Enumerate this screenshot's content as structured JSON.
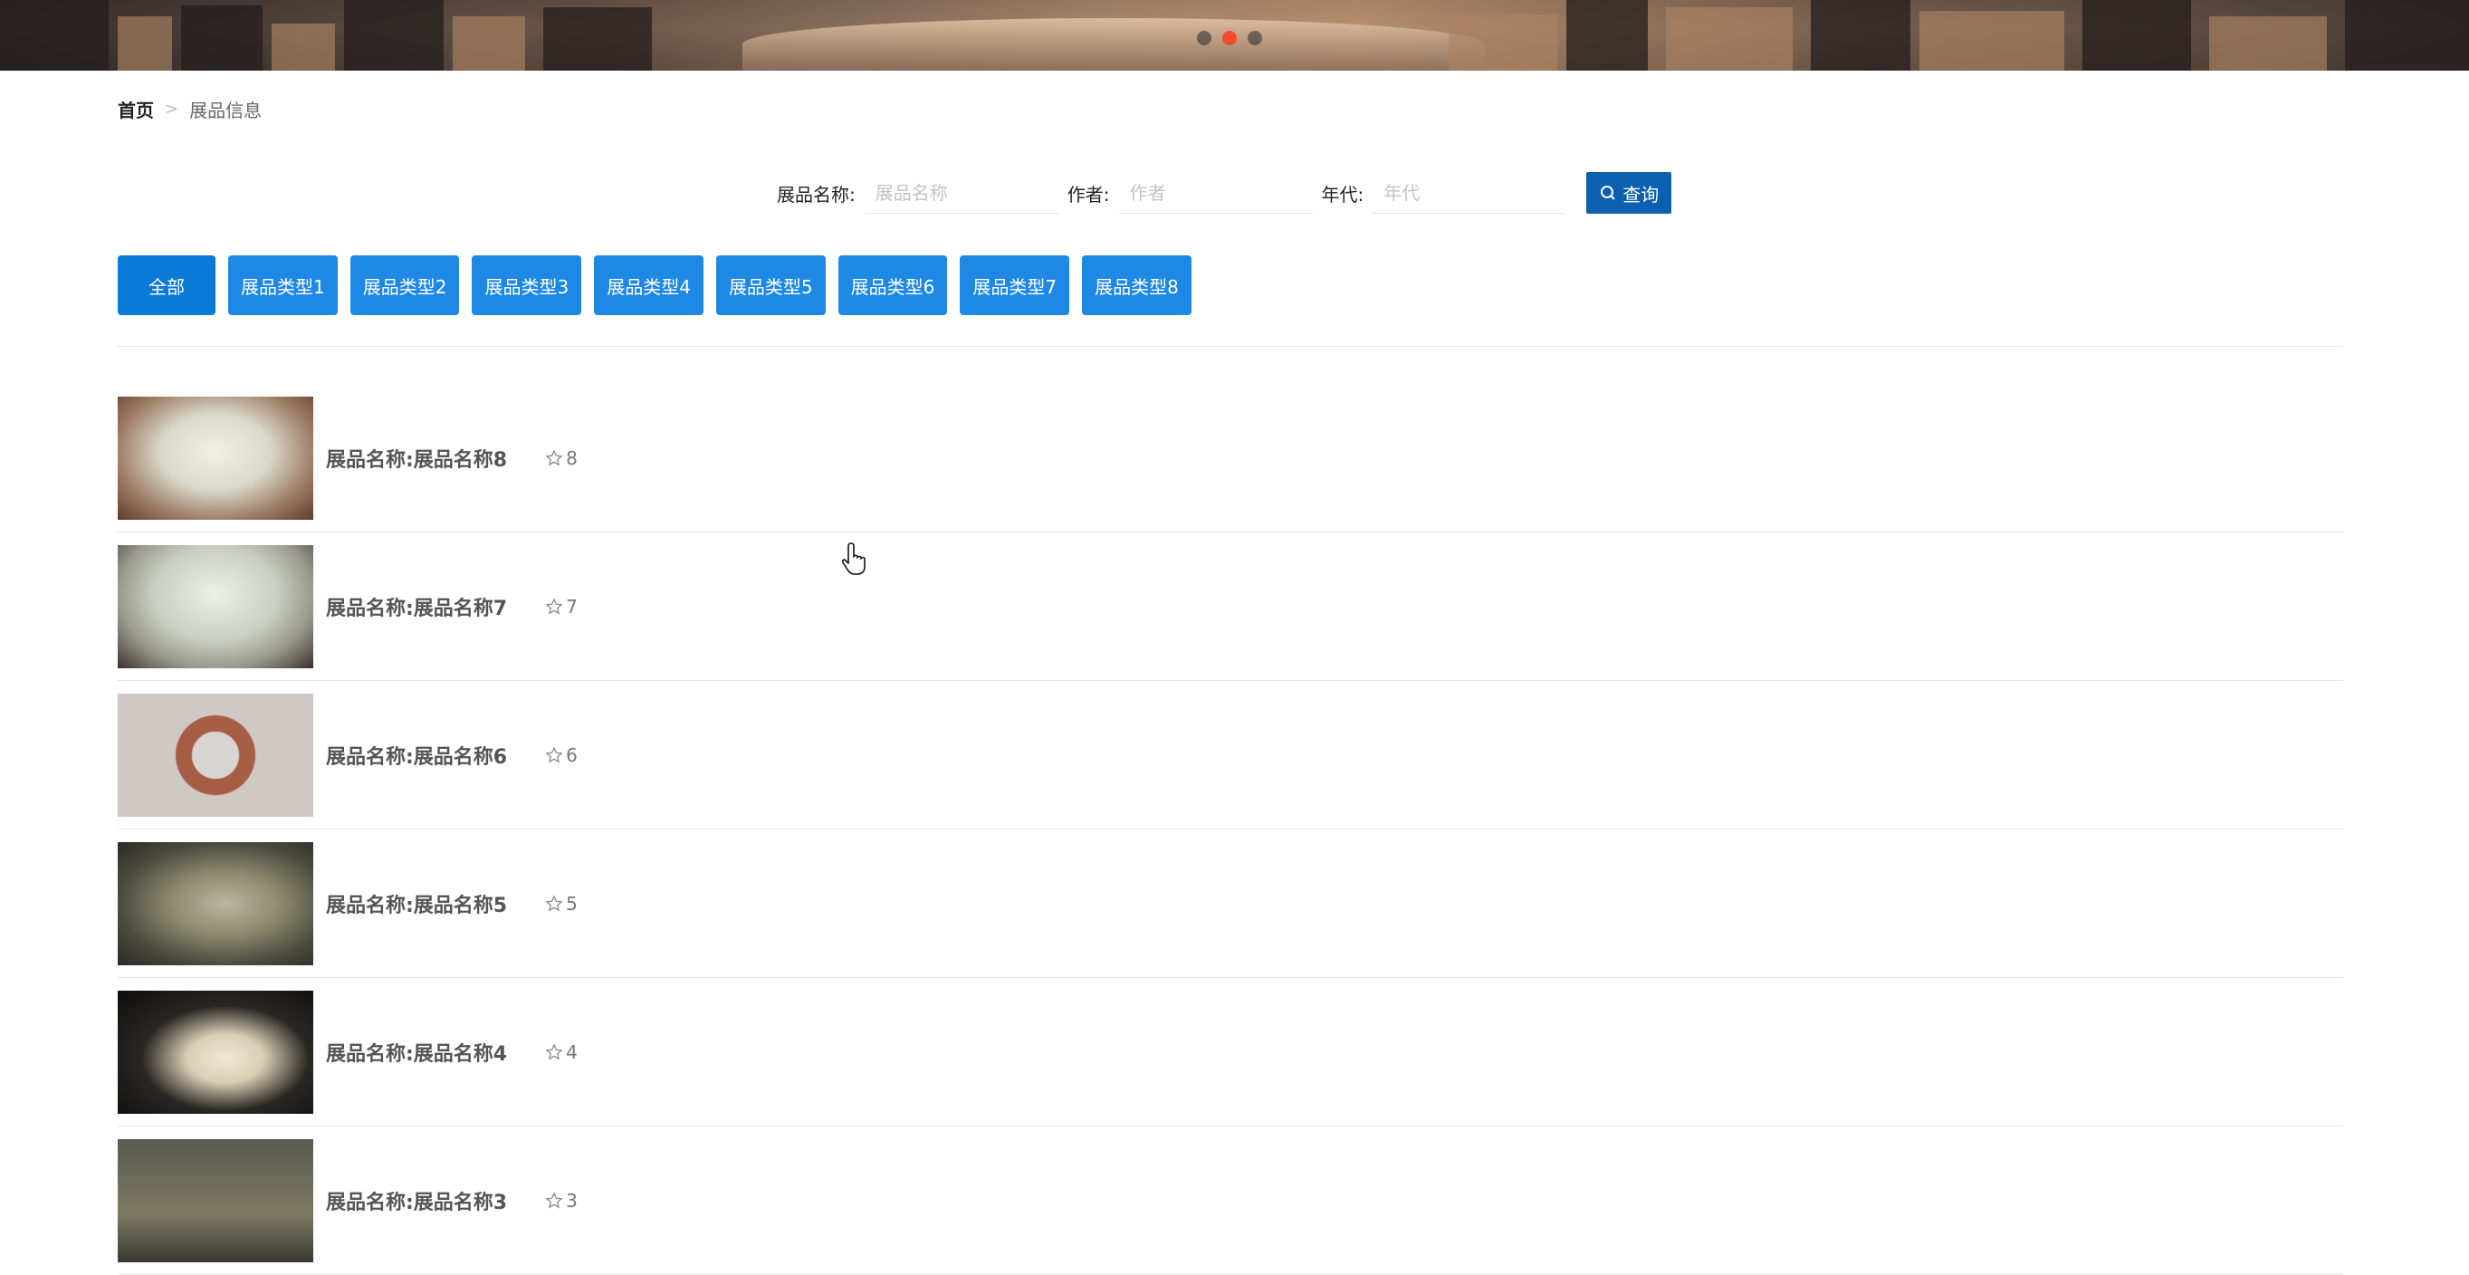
{
  "banner": {
    "slides": [
      "slide-1",
      "slide-2",
      "slide-3"
    ],
    "active_slide": 2
  },
  "breadcrumb": {
    "home": "首页",
    "separator": ">",
    "current": "展品信息"
  },
  "search": {
    "name_label": "展品名称:",
    "name_placeholder": "展品名称",
    "name_value": "",
    "author_label": "作者:",
    "author_placeholder": "作者",
    "author_value": "",
    "era_label": "年代:",
    "era_placeholder": "年代",
    "era_value": "",
    "button_label": "查询",
    "button_icon": "search-icon"
  },
  "categories": [
    {
      "label": "全部"
    },
    {
      "label": "展品类型1"
    },
    {
      "label": "展品类型2"
    },
    {
      "label": "展品类型3"
    },
    {
      "label": "展品类型4"
    },
    {
      "label": "展品类型5"
    },
    {
      "label": "展品类型6"
    },
    {
      "label": "展品类型7"
    },
    {
      "label": "展品类型8"
    }
  ],
  "items": [
    {
      "name": "展品名称:展品名称8",
      "favorites": "8"
    },
    {
      "name": "展品名称:展品名称7",
      "favorites": "7"
    },
    {
      "name": "展品名称:展品名称6",
      "favorites": "6"
    },
    {
      "name": "展品名称:展品名称5",
      "favorites": "5"
    },
    {
      "name": "展品名称:展品名称4",
      "favorites": "4"
    },
    {
      "name": "展品名称:展品名称3",
      "favorites": "3"
    }
  ],
  "colors": {
    "primary_button": "#0b60b0",
    "category_button": "#1e88e5",
    "category_all": "#0a7ad6",
    "active_dot": "#f24b2e"
  }
}
